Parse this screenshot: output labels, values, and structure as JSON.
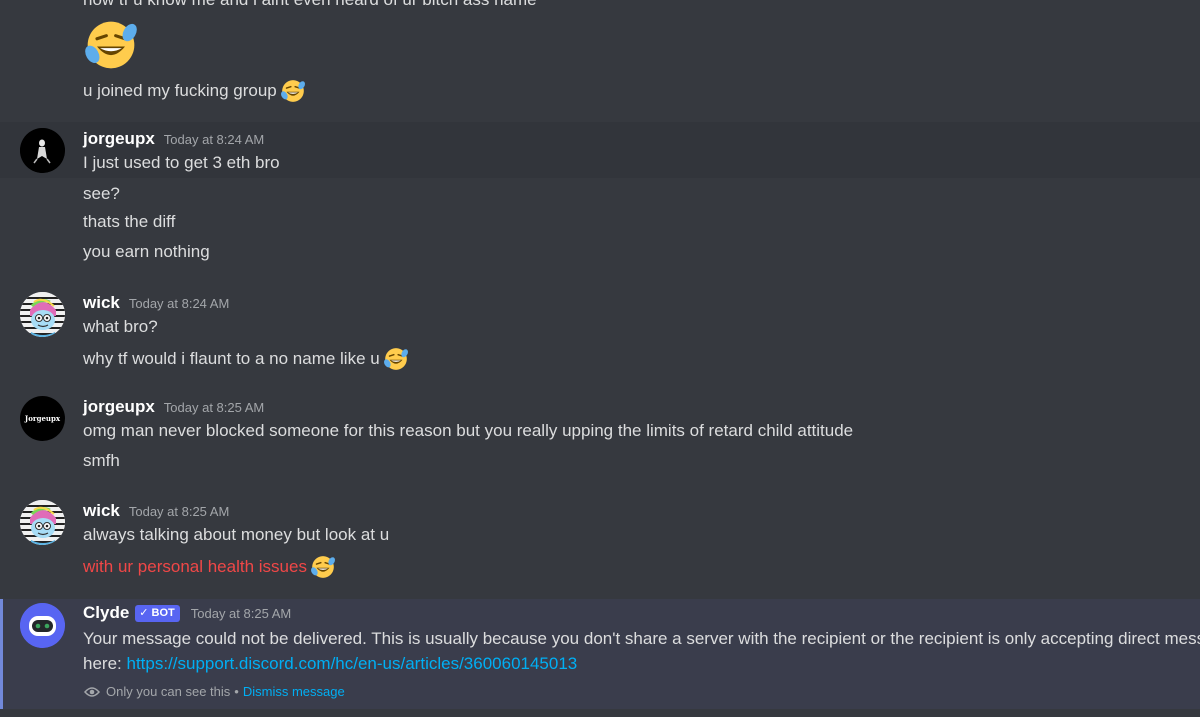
{
  "messages": {
    "m0": {
      "partial_line": "how tf u know me and i aint even heard of ur bitch ass name",
      "big_emoji": "rofl-emoji",
      "line2": "u joined my fucking group"
    },
    "m1": {
      "username": "jorgeupx",
      "timestamp": "Today at 8:24 AM",
      "lines": [
        "I just used to get 3 eth bro",
        "see?",
        "thats the diff",
        "you earn nothing"
      ]
    },
    "m2": {
      "username": "wick",
      "timestamp": "Today at 8:24 AM",
      "lines": [
        "what bro?",
        "why tf would i flaunt to a no name like u"
      ]
    },
    "m3": {
      "username": "jorgeupx",
      "timestamp": "Today at 8:25 AM",
      "avatar_text": "Jorgeupx",
      "lines": [
        "omg man never blocked someone for this reason but you really upping the limits of retard child attitude",
        "smfh"
      ]
    },
    "m4": {
      "username": "wick",
      "timestamp": "Today at 8:25 AM",
      "lines": [
        "always talking about money but look at u",
        "with ur personal health issues"
      ]
    },
    "m5": {
      "username": "Clyde",
      "badge": "BOT",
      "timestamp": "Today at 8:25 AM",
      "line1": "Your message could not be delivered. This is usually because you don't share a server with the recipient or the recipient is only accepting direct mess",
      "line2_prefix": "here: ",
      "link": "https://support.discord.com/hc/en-us/articles/360060145013",
      "ephemeral_note": "Only you can see this",
      "bullet": "•",
      "dismiss": "Dismiss message"
    }
  },
  "colors": {
    "background": "#36393f",
    "highlight": "#32353b",
    "clyde_bg": "#3a3d4c",
    "accent": "#5865f2",
    "link": "#00aff4",
    "red": "#f04747"
  }
}
